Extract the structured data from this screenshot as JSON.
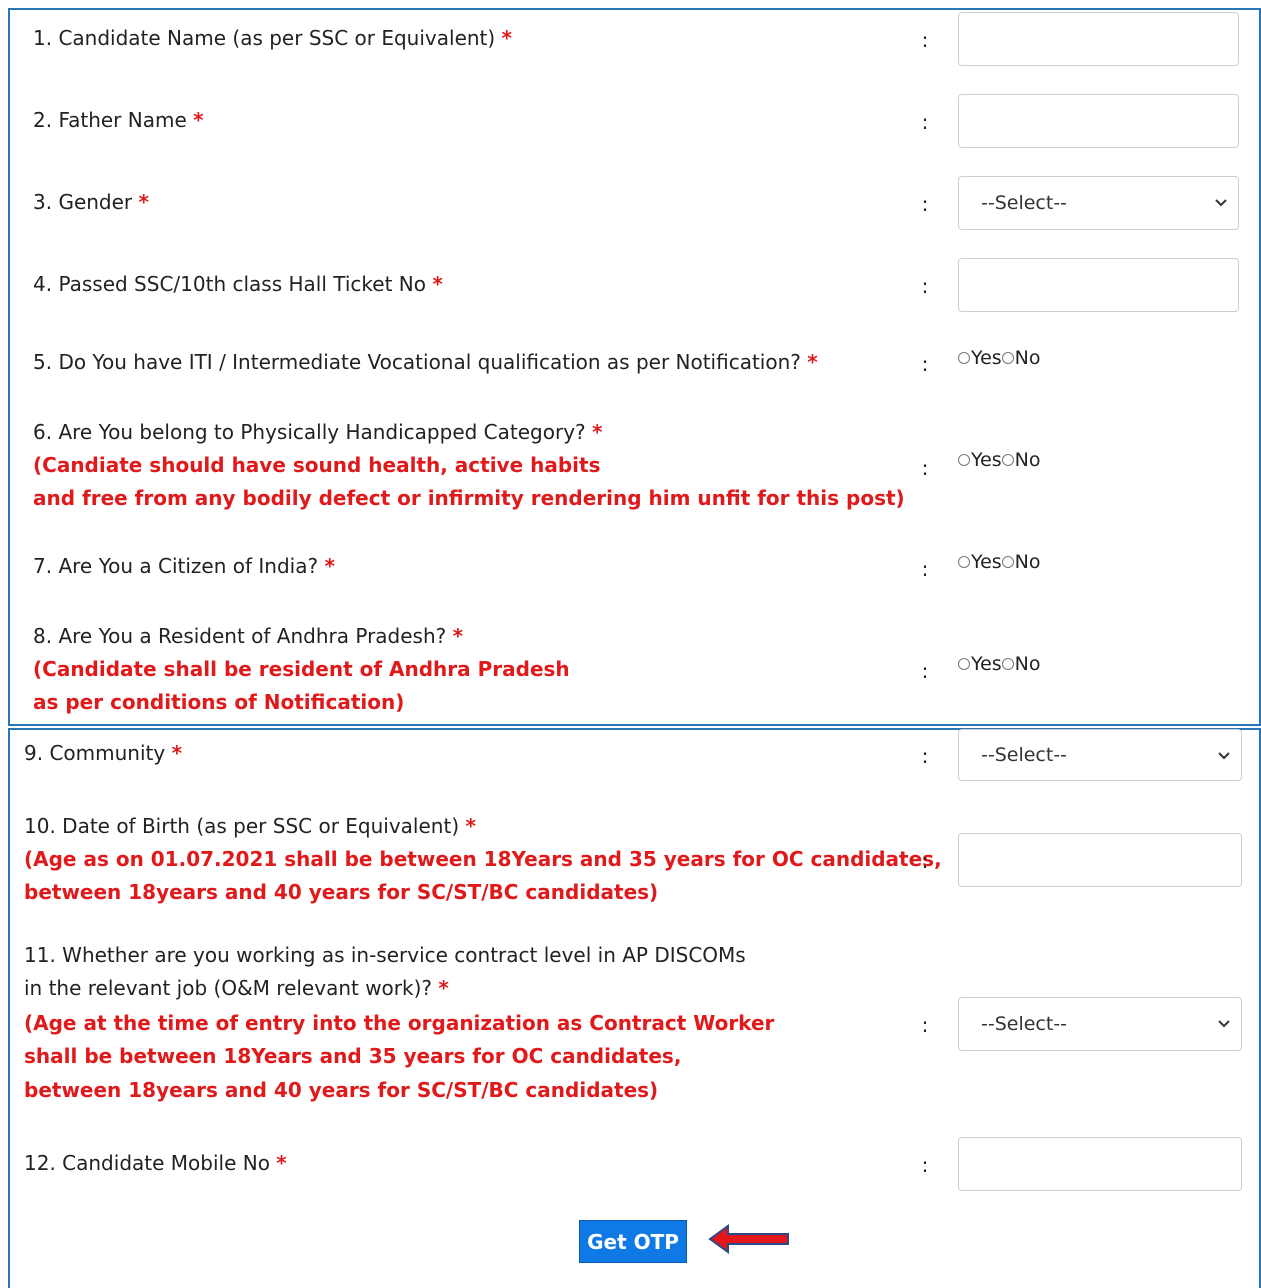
{
  "form": {
    "required_mark": "*",
    "colon": ":",
    "q1_label": "1. Candidate Name (as per SSC or Equivalent)",
    "q1_value": "",
    "q2_label": "2. Father Name",
    "q2_value": "",
    "q3_label": "3. Gender",
    "q3_selected": "--Select--",
    "q4_label": "4. Passed SSC/10th class Hall Ticket No",
    "q4_value": "",
    "q5_label": "5. Do You have ITI / Intermediate Vocational qualification as per Notification?",
    "q6_label": "6. Are You belong to Physically Handicapped Category?",
    "q6_note_line1": "(Candiate should have sound health, active habits",
    "q6_note_line2": "and free from any bodily defect or infirmity rendering him unfit for this post)",
    "q7_label": "7. Are You a Citizen of India?",
    "q8_label": "8. Are You a Resident of Andhra Pradesh?",
    "q8_note_line1": "(Candidate shall be resident of Andhra Pradesh",
    "q8_note_line2": "as per conditions of Notification)",
    "q9_label": "9. Community",
    "q9_selected": "--Select--",
    "q10_label": "10. Date of Birth (as per SSC or Equivalent)",
    "q10_note_line1": "(Age as on 01.07.2021 shall be between 18Years and 35 years for OC candidates,",
    "q10_note_line2": "between 18years and 40 years for SC/ST/BC candidates)",
    "q10_value": "",
    "q11_label_line1": "11. Whether are you working as in-service contract level in AP DISCOMs",
    "q11_label_line2": "in the relevant job (O&M relevant work)?",
    "q11_note_line1": "(Age at the time of entry into the organization as Contract Worker",
    "q11_note_line2": "shall be between 18Years and 35 years for OC candidates,",
    "q11_note_line3": "between 18years and 40 years for SC/ST/BC candidates)",
    "q11_selected": "--Select--",
    "q12_label": "12. Candidate Mobile No",
    "q12_value": "",
    "yes_label": "Yes",
    "no_label": "No",
    "get_otp_label": "Get OTP"
  },
  "icons": {
    "select_chevron": "chevron-down-icon",
    "pointer_arrow": "arrow-left-icon"
  },
  "colors": {
    "border": "#2a75b5",
    "required": "#e0191b",
    "button": "#0f7ae5"
  }
}
